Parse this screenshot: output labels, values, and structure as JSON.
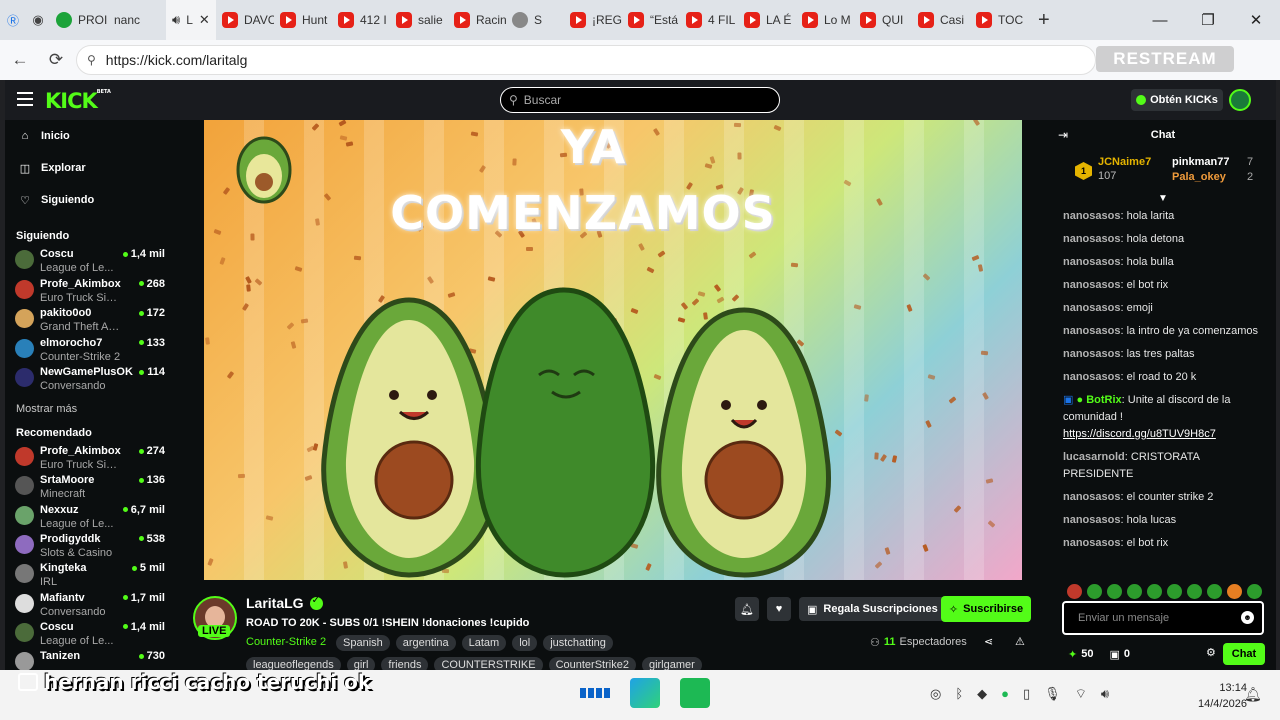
{
  "browser": {
    "tabs": [
      {
        "label": "PROI",
        "icon": "globe-icon",
        "kind": "glob"
      },
      {
        "label": "nanc",
        "icon": "kick-icon",
        "kind": "kick"
      },
      {
        "label": "L",
        "icon": "speaker-icon",
        "kind": "active"
      },
      {
        "label": "DAVC",
        "icon": "youtube-icon",
        "kind": "yt"
      },
      {
        "label": "Hunt",
        "icon": "youtube-icon",
        "kind": "yt"
      },
      {
        "label": "412 I",
        "icon": "youtube-icon",
        "kind": "yt"
      },
      {
        "label": "salie",
        "icon": "youtube-icon",
        "kind": "yt"
      },
      {
        "label": "Racin",
        "icon": "youtube-icon",
        "kind": "yt"
      },
      {
        "label": "S",
        "icon": "wolf-icon",
        "kind": "grey"
      },
      {
        "label": "¡REG",
        "icon": "youtube-icon",
        "kind": "yt"
      },
      {
        "label": "“Está",
        "icon": "youtube-icon",
        "kind": "yt"
      },
      {
        "label": "4 FIL",
        "icon": "youtube-icon",
        "kind": "yt"
      },
      {
        "label": "LA É",
        "icon": "youtube-icon",
        "kind": "yt"
      },
      {
        "label": "Lo M",
        "icon": "youtube-icon",
        "kind": "yt"
      },
      {
        "label": "QUI",
        "icon": "youtube-icon",
        "kind": "yt"
      },
      {
        "label": "Casi",
        "icon": "youtube-icon",
        "kind": "yt"
      },
      {
        "label": "TOC",
        "icon": "youtube-icon",
        "kind": "yt"
      }
    ],
    "url": "https://kick.com/laritalg",
    "restream_overlay": "RESTREAM"
  },
  "kick": {
    "logo": "KICK",
    "logo_badge": "BETA",
    "search_placeholder": "Buscar",
    "get_kicks": "Obtén KICKs",
    "nav": [
      "Inicio",
      "Explorar",
      "Siguiendo"
    ],
    "following_title": "Siguiendo",
    "following": [
      {
        "name": "Coscu",
        "category": "League of Le...",
        "viewers": "1,4 mil",
        "color": "#4b6b3a"
      },
      {
        "name": "Profe_Akimbox",
        "category": "Euro Truck Sim...",
        "viewers": "268",
        "color": "#c0392b"
      },
      {
        "name": "pakito0o0",
        "category": "Grand Theft Aut...",
        "viewers": "172",
        "color": "#d4a35a"
      },
      {
        "name": "elmorocho7",
        "category": "Counter-Strike 2",
        "viewers": "133",
        "color": "#2980b9"
      },
      {
        "name": "NewGamePlusOK",
        "category": "Conversando",
        "viewers": "114",
        "color": "#2c2c6c"
      }
    ],
    "show_more": "Mostrar más",
    "recommended_title": "Recomendado",
    "recommended": [
      {
        "name": "Profe_Akimbox",
        "category": "Euro Truck Sim...",
        "viewers": "274",
        "color": "#c0392b"
      },
      {
        "name": "SrtaMoore",
        "category": "Minecraft",
        "viewers": "136",
        "color": "#555555"
      },
      {
        "name": "Nexxuz",
        "category": "League of Le...",
        "viewers": "6,7 mil",
        "color": "#6aa36a"
      },
      {
        "name": "Prodigyddk",
        "category": "Slots & Casino",
        "viewers": "538",
        "color": "#8e6bbf"
      },
      {
        "name": "Kingteka",
        "category": "IRL",
        "viewers": "5 mil",
        "color": "#777777"
      },
      {
        "name": "Mafiantv",
        "category": "Conversando",
        "viewers": "1,7 mil",
        "color": "#dddddd"
      },
      {
        "name": "Coscu",
        "category": "League of Le...",
        "viewers": "1,4 mil",
        "color": "#4b6b3a"
      },
      {
        "name": "Tanizen",
        "category": "",
        "viewers": "730",
        "color": "#999999"
      }
    ],
    "video": {
      "line1": "YA",
      "line2": "COMENZAMOS"
    },
    "stream": {
      "streamer": "LaritaLG",
      "live_badge": "LIVE",
      "title": "ROAD TO 20K -  SUBS 0/1 !SHEIN !donaciones !cupido",
      "category": "Counter-Strike 2",
      "tags_row1": [
        "Spanish",
        "argentina",
        "Latam",
        "lol",
        "justchatting"
      ],
      "tags_row2": [
        "leagueoflegends",
        "girl",
        "friends",
        "COUNTERSTRIKE",
        "CounterStrike2",
        "girlgamer"
      ],
      "gift_subs": "Regala Suscripciones",
      "subscribe": "Suscribirse",
      "viewers_count": "11",
      "viewers_label": "Espectadores"
    },
    "chat": {
      "title": "Chat",
      "leaderboard": {
        "top_name": "JCNaime7",
        "top_count": "107",
        "second_name": "pinkman77",
        "second_count": "7",
        "third_name": "Pala_okey",
        "third_count": "2"
      },
      "messages": [
        {
          "user": "nanosasos",
          "text": "hola larita"
        },
        {
          "user": "nanosasos",
          "text": "hola detona"
        },
        {
          "user": "nanosasos",
          "text": "hola bulla"
        },
        {
          "user": "nanosasos",
          "text": "el bot rix"
        },
        {
          "user": "nanosasos",
          "text": "emoji"
        },
        {
          "user": "nanosasos",
          "text": "la intro de ya comenzamos"
        },
        {
          "user": "nanosasos",
          "text": "las tres paltas"
        },
        {
          "user": "nanosasos",
          "text": "el road to 20 k"
        },
        {
          "user": "BotRix",
          "text": "Unite al discord de la comunidad !",
          "link": "https://discord.gg/u8TUV9H8c7",
          "bot": true
        },
        {
          "user": "lucasarnold",
          "text": "CRISTORATA PRESIDENTE"
        },
        {
          "user": "nanosasos",
          "text": "el counter strike 2"
        },
        {
          "user": "nanosasos",
          "text": "hola lucas"
        },
        {
          "user": "nanosasos",
          "text": "el bot rix"
        }
      ],
      "input_placeholder": "Enviar un mensaje",
      "points": "50",
      "gifts": "0",
      "send_label": "Chat"
    }
  },
  "caption": "hernan ricci cacho teruchi ok",
  "taskbar": {
    "time": "13:14",
    "date": "14/4/2026"
  }
}
